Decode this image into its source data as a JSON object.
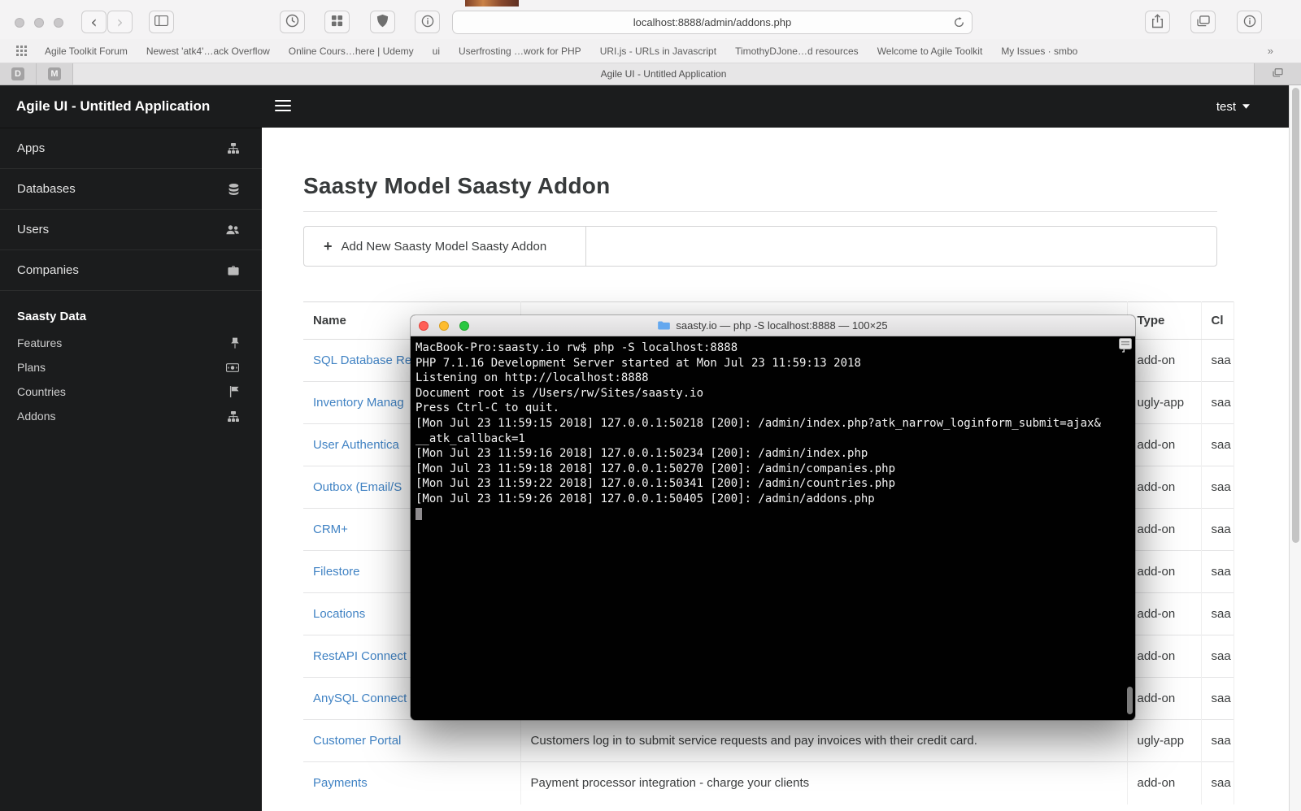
{
  "browser": {
    "url": "localhost:8888/admin/addons.php",
    "bookmarks": [
      "Agile Toolkit Forum",
      "Newest 'atk4'…ack Overflow",
      "Online Cours…here | Udemy",
      "ui",
      "Userfrosting …work for PHP",
      "URI.js - URLs in Javascript",
      "TimothyDJone…d resources",
      "Welcome to Agile Toolkit",
      "My Issues · smbo"
    ],
    "bookmarks_overflow": "»",
    "pinned_tabs": [
      "D",
      "M"
    ],
    "tab_title": "Agile UI - Untitled Application"
  },
  "app": {
    "nav_title": "Agile UI - Untitled Application",
    "user_menu": "test",
    "sidebar": {
      "items": [
        {
          "label": "Apps",
          "icon": "sitemap-icon"
        },
        {
          "label": "Databases",
          "icon": "database-icon"
        },
        {
          "label": "Users",
          "icon": "users-icon"
        },
        {
          "label": "Companies",
          "icon": "briefcase-icon"
        }
      ],
      "section": {
        "label": "Saasty Data",
        "items": [
          {
            "label": "Features",
            "icon": "pin-icon"
          },
          {
            "label": "Plans",
            "icon": "money-icon"
          },
          {
            "label": "Countries",
            "icon": "flag-icon"
          },
          {
            "label": "Addons",
            "icon": "sitemap-icon"
          }
        ]
      }
    },
    "page": {
      "title": "Saasty Model Saasty Addon",
      "add_button_label": "Add New Saasty Model Saasty Addon",
      "table": {
        "headers": [
          "Name",
          "",
          "Type",
          "Cl"
        ],
        "rows": [
          {
            "name": "SQL Database Re",
            "descr": "",
            "type": "add-on",
            "cl": "saa"
          },
          {
            "name": "Inventory Manag",
            "descr": "",
            "type": "ugly-app",
            "cl": "saa"
          },
          {
            "name": "User Authentica",
            "descr": "",
            "type": "add-on",
            "cl": "saa"
          },
          {
            "name": "Outbox (Email/S",
            "descr": "",
            "type": "add-on",
            "cl": "saa"
          },
          {
            "name": "CRM+",
            "descr": "",
            "type": "add-on",
            "cl": "saa"
          },
          {
            "name": "Filestore",
            "descr": "",
            "type": "add-on",
            "cl": "saa"
          },
          {
            "name": "Locations",
            "descr": "",
            "type": "add-on",
            "cl": "saa"
          },
          {
            "name": "RestAPI Connect",
            "descr": "",
            "type": "add-on",
            "cl": "saa"
          },
          {
            "name": "AnySQL Connect",
            "descr": "",
            "type": "add-on",
            "cl": "saa"
          },
          {
            "name": "Customer Portal",
            "descr": "Customers log in to submit service requests and pay invoices with their credit card.",
            "type": "ugly-app",
            "cl": "saa"
          },
          {
            "name": "Payments",
            "descr": "Payment processor integration - charge your clients",
            "type": "add-on",
            "cl": "saa"
          }
        ]
      }
    }
  },
  "terminal": {
    "title": "saasty.io — php -S localhost:8888 — 100×25",
    "first_line_mark": "]",
    "lines": [
      "MacBook-Pro:saasty.io rw$ php -S localhost:8888",
      "PHP 7.1.16 Development Server started at Mon Jul 23 11:59:13 2018",
      "Listening on http://localhost:8888",
      "Document root is /Users/rw/Sites/saasty.io",
      "Press Ctrl-C to quit.",
      "[Mon Jul 23 11:59:15 2018] 127.0.0.1:50218 [200]: /admin/index.php?atk_narrow_loginform_submit=ajax&",
      "__atk_callback=1",
      "[Mon Jul 23 11:59:16 2018] 127.0.0.1:50234 [200]: /admin/index.php",
      "[Mon Jul 23 11:59:18 2018] 127.0.0.1:50270 [200]: /admin/companies.php",
      "[Mon Jul 23 11:59:22 2018] 127.0.0.1:50341 [200]: /admin/countries.php",
      "[Mon Jul 23 11:59:26 2018] 127.0.0.1:50405 [200]: /admin/addons.php"
    ]
  },
  "theme": {
    "nav_bg": "#1b1c1d",
    "link_color": "#4183c4",
    "terminal_bg": "#010101"
  }
}
